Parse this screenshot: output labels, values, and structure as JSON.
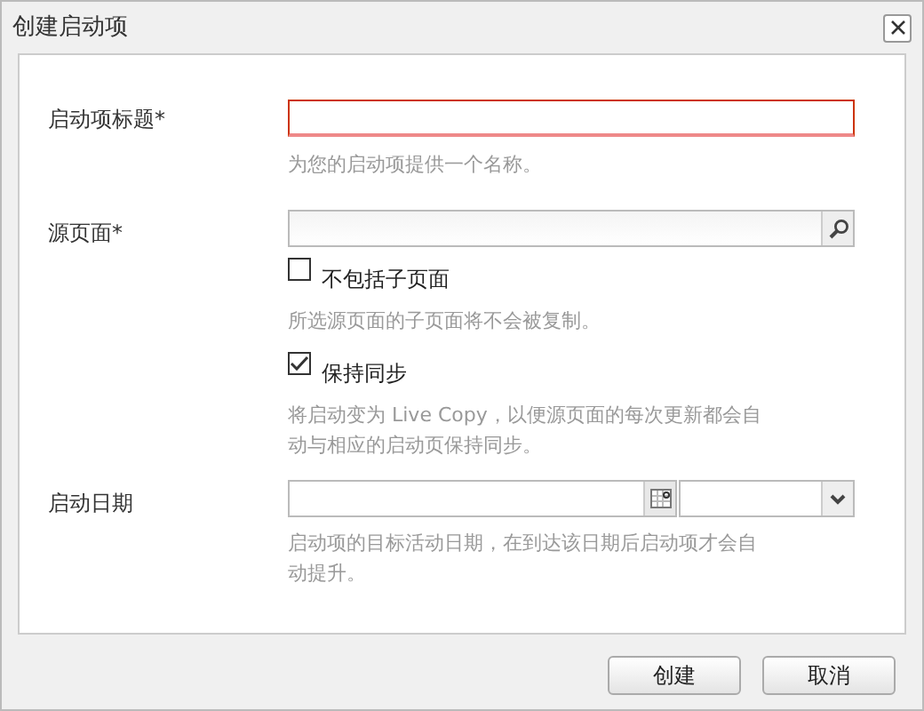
{
  "window": {
    "title": "创建启动项"
  },
  "fields": [
    {
      "kind": "text",
      "label": "启动项标题*",
      "invalid": true,
      "hint": "为您的启动项提供一个名称。"
    },
    {
      "kind": "search",
      "label": "源页面*"
    },
    {
      "kind": "checkbox",
      "checked": false,
      "text": "不包括子页面",
      "hint": "所选源页面的子页面将不会被复制。"
    },
    {
      "kind": "checkbox",
      "checked": true,
      "text": "保持同步",
      "hint": "将启动变为 Live Copy，以便源页面的每次更新都会自动与相应的启动页保持同步。"
    },
    {
      "kind": "date",
      "label": "启动日期",
      "hint": "启动项的目标活动日期，在到达该日期后启动项才会自动提升。"
    }
  ],
  "buttons": [
    "创建",
    "取消"
  ]
}
